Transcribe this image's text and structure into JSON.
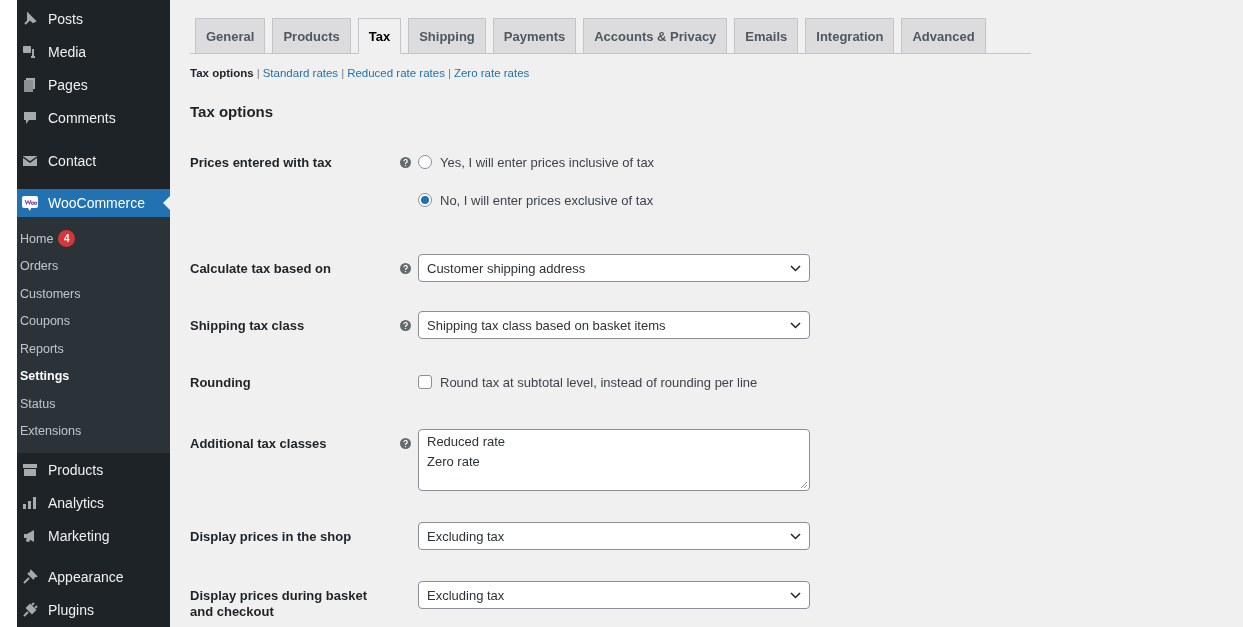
{
  "sidebar": {
    "items": [
      {
        "label": "Posts",
        "selected": false
      },
      {
        "label": "Media",
        "selected": false
      },
      {
        "label": "Pages",
        "selected": false
      },
      {
        "label": "Comments",
        "selected": false
      },
      {
        "label": "Contact",
        "selected": false
      },
      {
        "label": "WooCommerce",
        "selected": true,
        "children": [
          {
            "label": "Home",
            "selected": false,
            "badge": "4"
          },
          {
            "label": "Orders",
            "selected": false
          },
          {
            "label": "Customers",
            "selected": false
          },
          {
            "label": "Coupons",
            "selected": false
          },
          {
            "label": "Reports",
            "selected": false
          },
          {
            "label": "Settings",
            "selected": true
          },
          {
            "label": "Status",
            "selected": false
          },
          {
            "label": "Extensions",
            "selected": false
          }
        ]
      },
      {
        "label": "Products",
        "selected": false
      },
      {
        "label": "Analytics",
        "selected": false
      },
      {
        "label": "Marketing",
        "selected": false
      },
      {
        "label": "Appearance",
        "selected": false
      },
      {
        "label": "Plugins",
        "selected": false
      }
    ]
  },
  "tabs": [
    {
      "label": "General",
      "selected": false
    },
    {
      "label": "Products",
      "selected": false
    },
    {
      "label": "Tax",
      "selected": true
    },
    {
      "label": "Shipping",
      "selected": false
    },
    {
      "label": "Payments",
      "selected": false
    },
    {
      "label": "Accounts & Privacy",
      "selected": false
    },
    {
      "label": "Emails",
      "selected": false
    },
    {
      "label": "Integration",
      "selected": false
    },
    {
      "label": "Advanced",
      "selected": false
    }
  ],
  "subnav": [
    {
      "label": "Tax options",
      "selected": true
    },
    {
      "separator": "|",
      "label": "Standard rates",
      "selected": false
    },
    {
      "separator": "|",
      "label": "Reduced rate rates",
      "selected": false
    },
    {
      "separator": "|",
      "label": "Zero rate rates",
      "selected": false
    }
  ],
  "heading": "Tax options",
  "fields": [
    {
      "kind": "radio",
      "label": "Prices entered with tax",
      "help": true,
      "options": [
        {
          "label": "Yes, I will enter prices inclusive of tax",
          "selected": false
        },
        {
          "label": "No, I will enter prices exclusive of tax",
          "selected": true
        }
      ]
    },
    {
      "kind": "select",
      "label": "Calculate tax based on",
      "help": true,
      "value": "Customer shipping address"
    },
    {
      "kind": "select",
      "label": "Shipping tax class",
      "help": true,
      "value": "Shipping tax class based on basket items"
    },
    {
      "kind": "checkbox",
      "label": "Rounding",
      "help": false,
      "option": "Round tax at subtotal level, instead of rounding per line",
      "checked": false
    },
    {
      "kind": "textarea",
      "label": "Additional tax classes",
      "help": true,
      "value": "Reduced rate\nZero rate"
    },
    {
      "kind": "select",
      "label": "Display prices in the shop",
      "help": false,
      "value": "Excluding tax"
    },
    {
      "kind": "select",
      "label": "Display prices during basket and checkout",
      "help": false,
      "value": "Excluding tax"
    }
  ]
}
